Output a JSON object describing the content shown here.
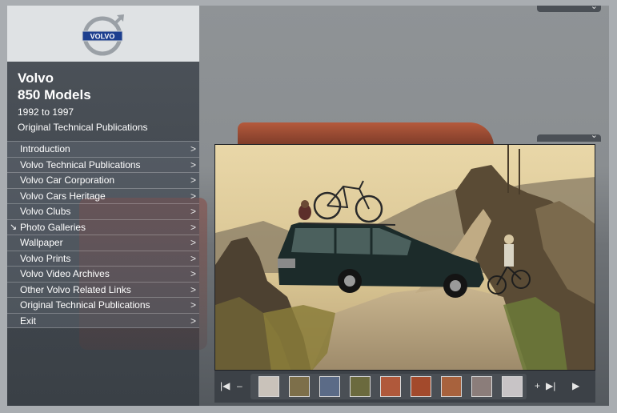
{
  "header": {
    "logo_text": "VOLVO",
    "brand": "Volvo",
    "model": "850 Models",
    "years": "1992 to 1997",
    "publications": "Original Technical Publications"
  },
  "menu": {
    "items": [
      {
        "label": "Introduction",
        "selected": false
      },
      {
        "label": "Volvo Technical Publications",
        "selected": false
      },
      {
        "label": "Volvo Car Corporation",
        "selected": false
      },
      {
        "label": "Volvo Cars Heritage",
        "selected": false
      },
      {
        "label": "Volvo Clubs",
        "selected": false
      },
      {
        "label": "Photo Galleries",
        "selected": true
      },
      {
        "label": "Wallpaper",
        "selected": false
      },
      {
        "label": "Volvo Prints",
        "selected": false
      },
      {
        "label": "Volvo Video Archives",
        "selected": false
      },
      {
        "label": "Other Volvo Related Links",
        "selected": false
      },
      {
        "label": "Original Technical Publications",
        "selected": false
      },
      {
        "label": "Exit",
        "selected": false
      }
    ],
    "chevron_glyph": ">",
    "selected_glyph": "↘"
  },
  "filmstrip": {
    "thumbnail_count": 9,
    "thumb_colors": [
      "#c9c2ba",
      "#7d6f4a",
      "#5b6b87",
      "#6b6a3e",
      "#b0593b",
      "#a34a2c",
      "#a8623d",
      "#8b7d7a",
      "#c8c4c6"
    ],
    "controls": {
      "first": "first-icon",
      "zoom_out": "minus-icon",
      "zoom_in": "plus-icon",
      "next_page": "next-page-icon",
      "play": "play-icon"
    }
  },
  "colors": {
    "panel_dark": "#3d4248",
    "logo_blue": "#1d3f8f",
    "logo_silver": "#9aa0a6"
  }
}
